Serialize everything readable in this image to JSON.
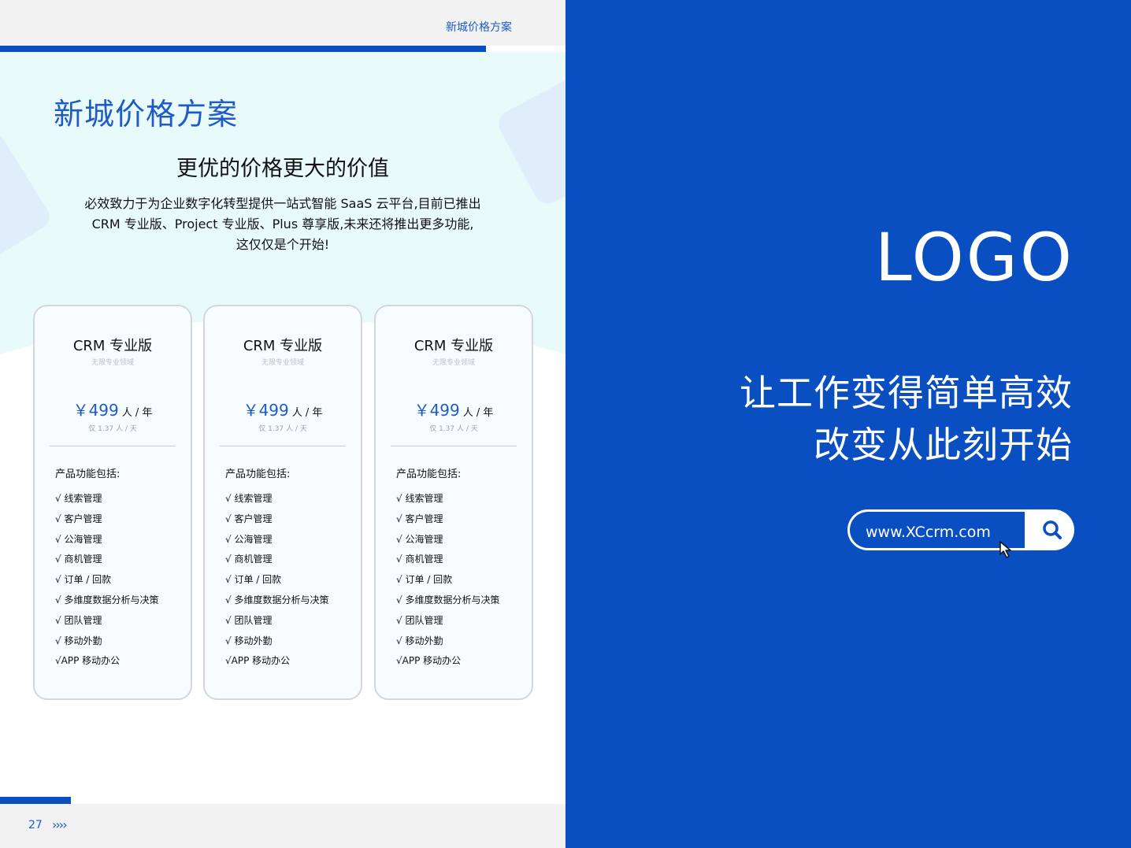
{
  "left_page": {
    "header_title": "新城价格方案",
    "page_title": "新城价格方案",
    "subtitle": "更优的价格更大的价值",
    "description_lines": [
      "必效致力于为企业数字化转型提供一站式智能 SaaS 云平台,目前已推出",
      "CRM 专业版、Project 专业版、Plus 尊享版,未来还将推出更多功能,",
      "这仅仅是个开始!"
    ],
    "cards": [
      {
        "title": "CRM 专业版",
        "subtitle": "无限专业领域",
        "price": "￥499",
        "unit": "人 / 年",
        "daily": "仅 1.37 人 / 天",
        "features_heading": "产品功能包括:",
        "features": [
          "√ 线索管理",
          "√ 客户管理",
          "√ 公海管理",
          "√ 商机管理",
          "√ 订单 / 回款",
          "√ 多维度数据分析与决策",
          "√ 团队管理",
          "√ 移动外勤",
          "√APP 移动办公"
        ]
      },
      {
        "title": "CRM 专业版",
        "subtitle": "无限专业领域",
        "price": "￥499",
        "unit": "人 / 年",
        "daily": "仅 1.37 人 / 天",
        "features_heading": "产品功能包括:",
        "features": [
          "√ 线索管理",
          "√ 客户管理",
          "√ 公海管理",
          "√ 商机管理",
          "√ 订单 / 回款",
          "√ 多维度数据分析与决策",
          "√ 团队管理",
          "√ 移动外勤",
          "√APP 移动办公"
        ]
      },
      {
        "title": "CRM 专业版",
        "subtitle": "无限专业领域",
        "price": "￥499",
        "unit": "人 / 年",
        "daily": "仅 1.37 人 / 天",
        "features_heading": "产品功能包括:",
        "features": [
          "√ 线索管理",
          "√ 客户管理",
          "√ 公海管理",
          "√ 商机管理",
          "√ 订单 / 回款",
          "√ 多维度数据分析与决策",
          "√ 团队管理",
          "√ 移动外勤",
          "√APP 移动办公"
        ]
      }
    ],
    "page_number": "27",
    "page_arrows": "››››"
  },
  "right_page": {
    "logo": "LOGO",
    "slogan_lines": [
      "让工作变得简单高效",
      "改变从此刻开始"
    ],
    "url": "www.XCcrm.com",
    "search_icon": "search-icon",
    "cursor_icon": "cursor-icon"
  },
  "colors": {
    "brand_blue": "#0a4fc2",
    "accent_text": "#1e5bc6",
    "hero_bg": "#e9fafb"
  }
}
